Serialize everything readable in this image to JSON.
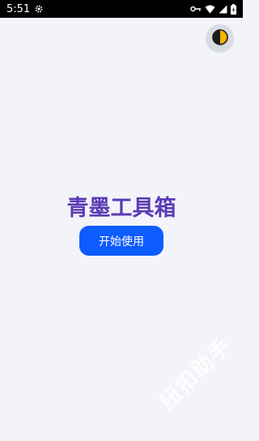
{
  "status_bar": {
    "time": "5:51",
    "icons": [
      "settings-gear-icon",
      "vpn-key-icon",
      "wifi-icon",
      "signal-icon",
      "battery-icon"
    ]
  },
  "theme_toggle": {
    "icon": "half-moon-contrast-icon",
    "colors": {
      "dark": "#1c1c1c",
      "light": "#f5b400"
    }
  },
  "main": {
    "title": "青墨工具箱",
    "start_button_label": "开始使用"
  },
  "watermark": {
    "text": "纽扣助手"
  },
  "colors": {
    "background": "#f2f4f9",
    "title": "#5b3bb5",
    "button": "#0d5cff"
  }
}
